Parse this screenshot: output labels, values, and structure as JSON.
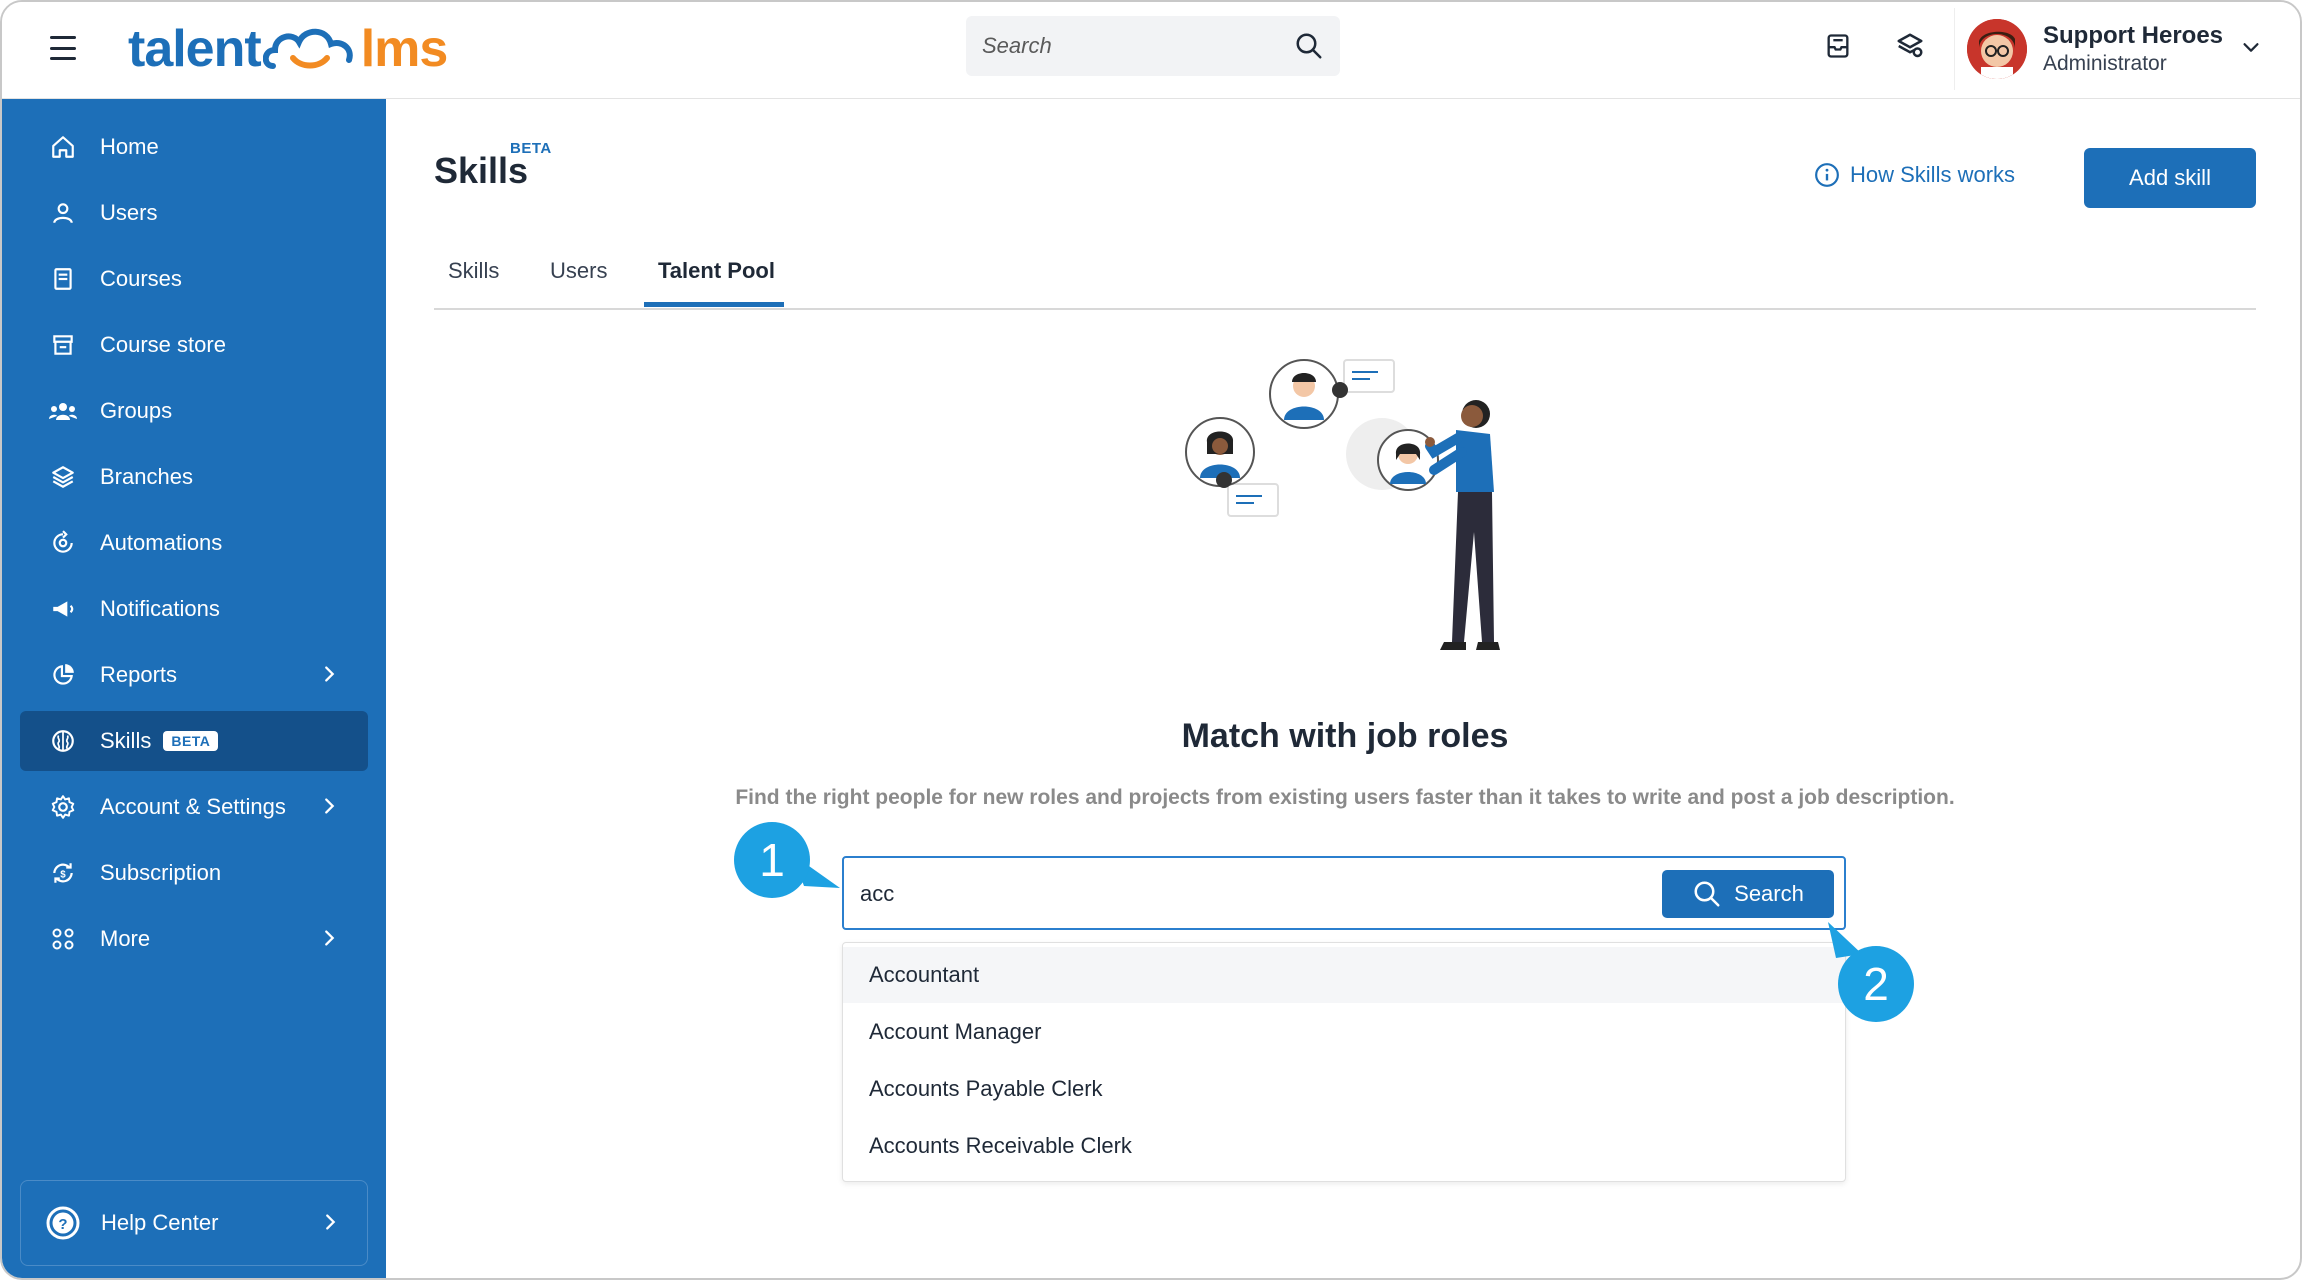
{
  "app": {
    "logo_left": "talent",
    "logo_right": "lms"
  },
  "topbar": {
    "search_placeholder": "Search",
    "user_name": "Support Heroes",
    "user_role": "Administrator"
  },
  "sidebar": {
    "items": [
      {
        "label": "Home",
        "icon": "home-icon"
      },
      {
        "label": "Users",
        "icon": "user-icon"
      },
      {
        "label": "Courses",
        "icon": "book-icon"
      },
      {
        "label": "Course store",
        "icon": "store-icon"
      },
      {
        "label": "Groups",
        "icon": "groups-icon"
      },
      {
        "label": "Branches",
        "icon": "layers-icon"
      },
      {
        "label": "Automations",
        "icon": "automation-icon"
      },
      {
        "label": "Notifications",
        "icon": "megaphone-icon"
      },
      {
        "label": "Reports",
        "icon": "pie-chart-icon"
      },
      {
        "label": "Skills",
        "icon": "brain-icon",
        "badge": "BETA",
        "active": true
      },
      {
        "label": "Account & Settings",
        "icon": "gear-icon"
      },
      {
        "label": "Subscription",
        "icon": "subscription-icon"
      },
      {
        "label": "More",
        "icon": "grid-icon"
      }
    ],
    "help_label": "Help Center"
  },
  "main": {
    "title": "Skills",
    "title_badge": "BETA",
    "how_link": "How Skills works",
    "add_button": "Add skill",
    "tabs": [
      {
        "label": "Skills"
      },
      {
        "label": "Users"
      },
      {
        "label": "Talent Pool",
        "active": true
      }
    ],
    "heading": "Match with job roles",
    "description": "Find the right people for new roles and projects from existing users faster than it takes to write and post a job description.",
    "job_search_value": "acc",
    "search_button": "Search",
    "suggestions": [
      "Accountant",
      "Account Manager",
      "Accounts Payable Clerk",
      "Accounts Receivable Clerk"
    ]
  },
  "callouts": [
    "1",
    "2"
  ],
  "colors": {
    "brand_blue": "#1d6fb8",
    "brand_orange": "#f28b22",
    "sidebar_active": "#14508a",
    "callout": "#1da1e2"
  }
}
